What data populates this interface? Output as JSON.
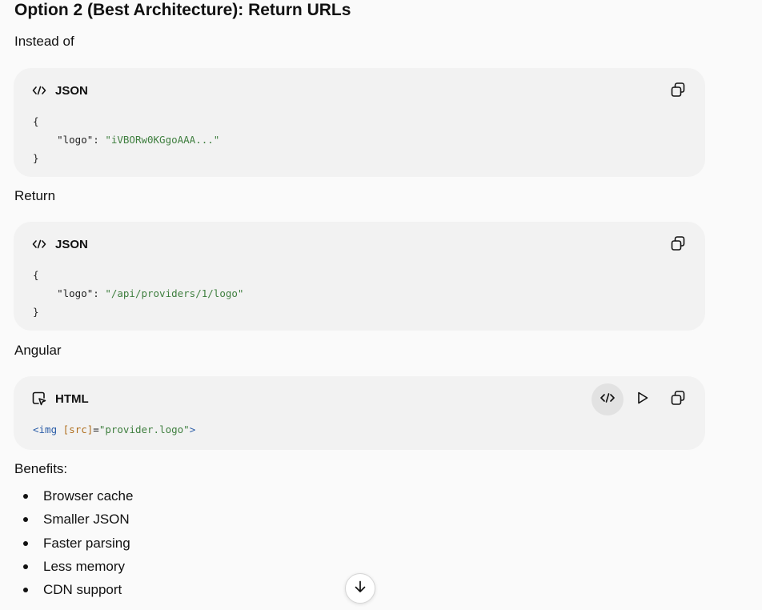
{
  "heading": "Option 2 (Best Architecture): Return URLs",
  "p_instead": "Instead of",
  "p_return": "Return",
  "p_angular": "Angular",
  "p_benefits": "Benefits:",
  "block1": {
    "lang": "JSON",
    "open": "{",
    "key": "\"logo\"",
    "colon": ": ",
    "value": "\"iVBORw0KGgoAAA...\"",
    "close": "}"
  },
  "block2": {
    "lang": "JSON",
    "open": "{",
    "key": "\"logo\"",
    "colon": ": ",
    "value": "\"/api/providers/1/logo\"",
    "close": "}"
  },
  "block3": {
    "lang": "HTML",
    "tag_open": "<img",
    "attr": "[src]",
    "eq": "=",
    "value": "\"provider.logo\"",
    "tag_close": ">"
  },
  "benefits": [
    "Browser cache",
    "Smaller JSON",
    "Faster parsing",
    "Less memory",
    "CDN support"
  ],
  "icons": {
    "json_lang": "code-icon",
    "html_lang": "html-preview-icon",
    "copy": "copy-icon",
    "view_code": "code-view-icon",
    "run": "play-icon",
    "scroll_down": "arrow-down-icon"
  }
}
